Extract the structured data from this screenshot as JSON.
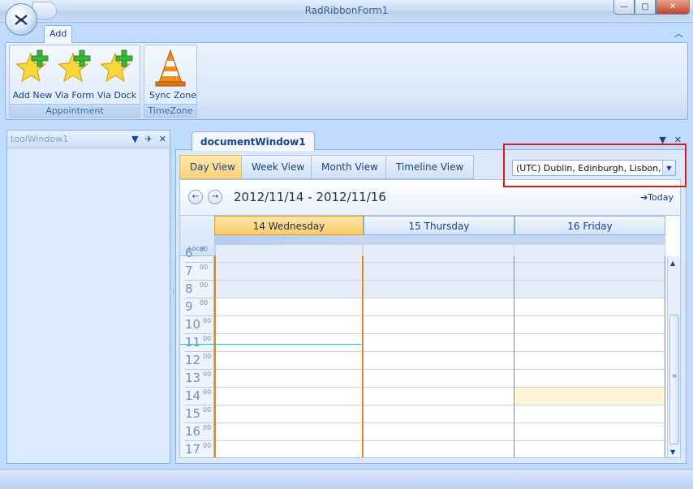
{
  "window": {
    "title": "RadRibbonForm1",
    "minimize": "—",
    "maximize": "□",
    "close": "✕"
  },
  "ribbon": {
    "tabs": [
      {
        "label": "Add"
      }
    ],
    "collapse_icon": "chevron-up-icon",
    "groups": [
      {
        "label": "Appointment",
        "buttons": [
          {
            "label": "Add New",
            "icon": "star-plus-icon"
          },
          {
            "label": "Via Form",
            "icon": "star-plus-icon"
          },
          {
            "label": "Via Dock",
            "icon": "star-plus-icon"
          }
        ]
      },
      {
        "label": "TimeZone",
        "buttons": [
          {
            "label": "Sync Zone",
            "icon": "traffic-cone-icon"
          }
        ]
      }
    ]
  },
  "tool_window": {
    "title": "toolWindow1"
  },
  "document_window": {
    "title": "documentWindow1"
  },
  "scheduler": {
    "views": [
      {
        "label": "Day View",
        "active": true
      },
      {
        "label": "Week View",
        "active": false
      },
      {
        "label": "Month View",
        "active": false
      },
      {
        "label": "Timeline View",
        "active": false
      }
    ],
    "timezone": "(UTC) Dublin, Edinburgh, Lisbon, L",
    "date_range": "2012/11/14 - 2012/11/16",
    "today_label": "Today",
    "ruler_label": "Local",
    "days": [
      {
        "label": "14 Wednesday",
        "is_today": true
      },
      {
        "label": "15 Thursday",
        "is_today": false
      },
      {
        "label": "16 Friday",
        "is_today": false
      }
    ],
    "hours": [
      "6",
      "7",
      "8",
      "9",
      "10",
      "11",
      "12",
      "13",
      "14",
      "15",
      "16",
      "17"
    ],
    "minutes": "00"
  },
  "colors": {
    "accent": "#15428b",
    "today_header": "#fbd27a",
    "highlight_box": "#e2161c",
    "now_line": "#1ec4b4"
  }
}
